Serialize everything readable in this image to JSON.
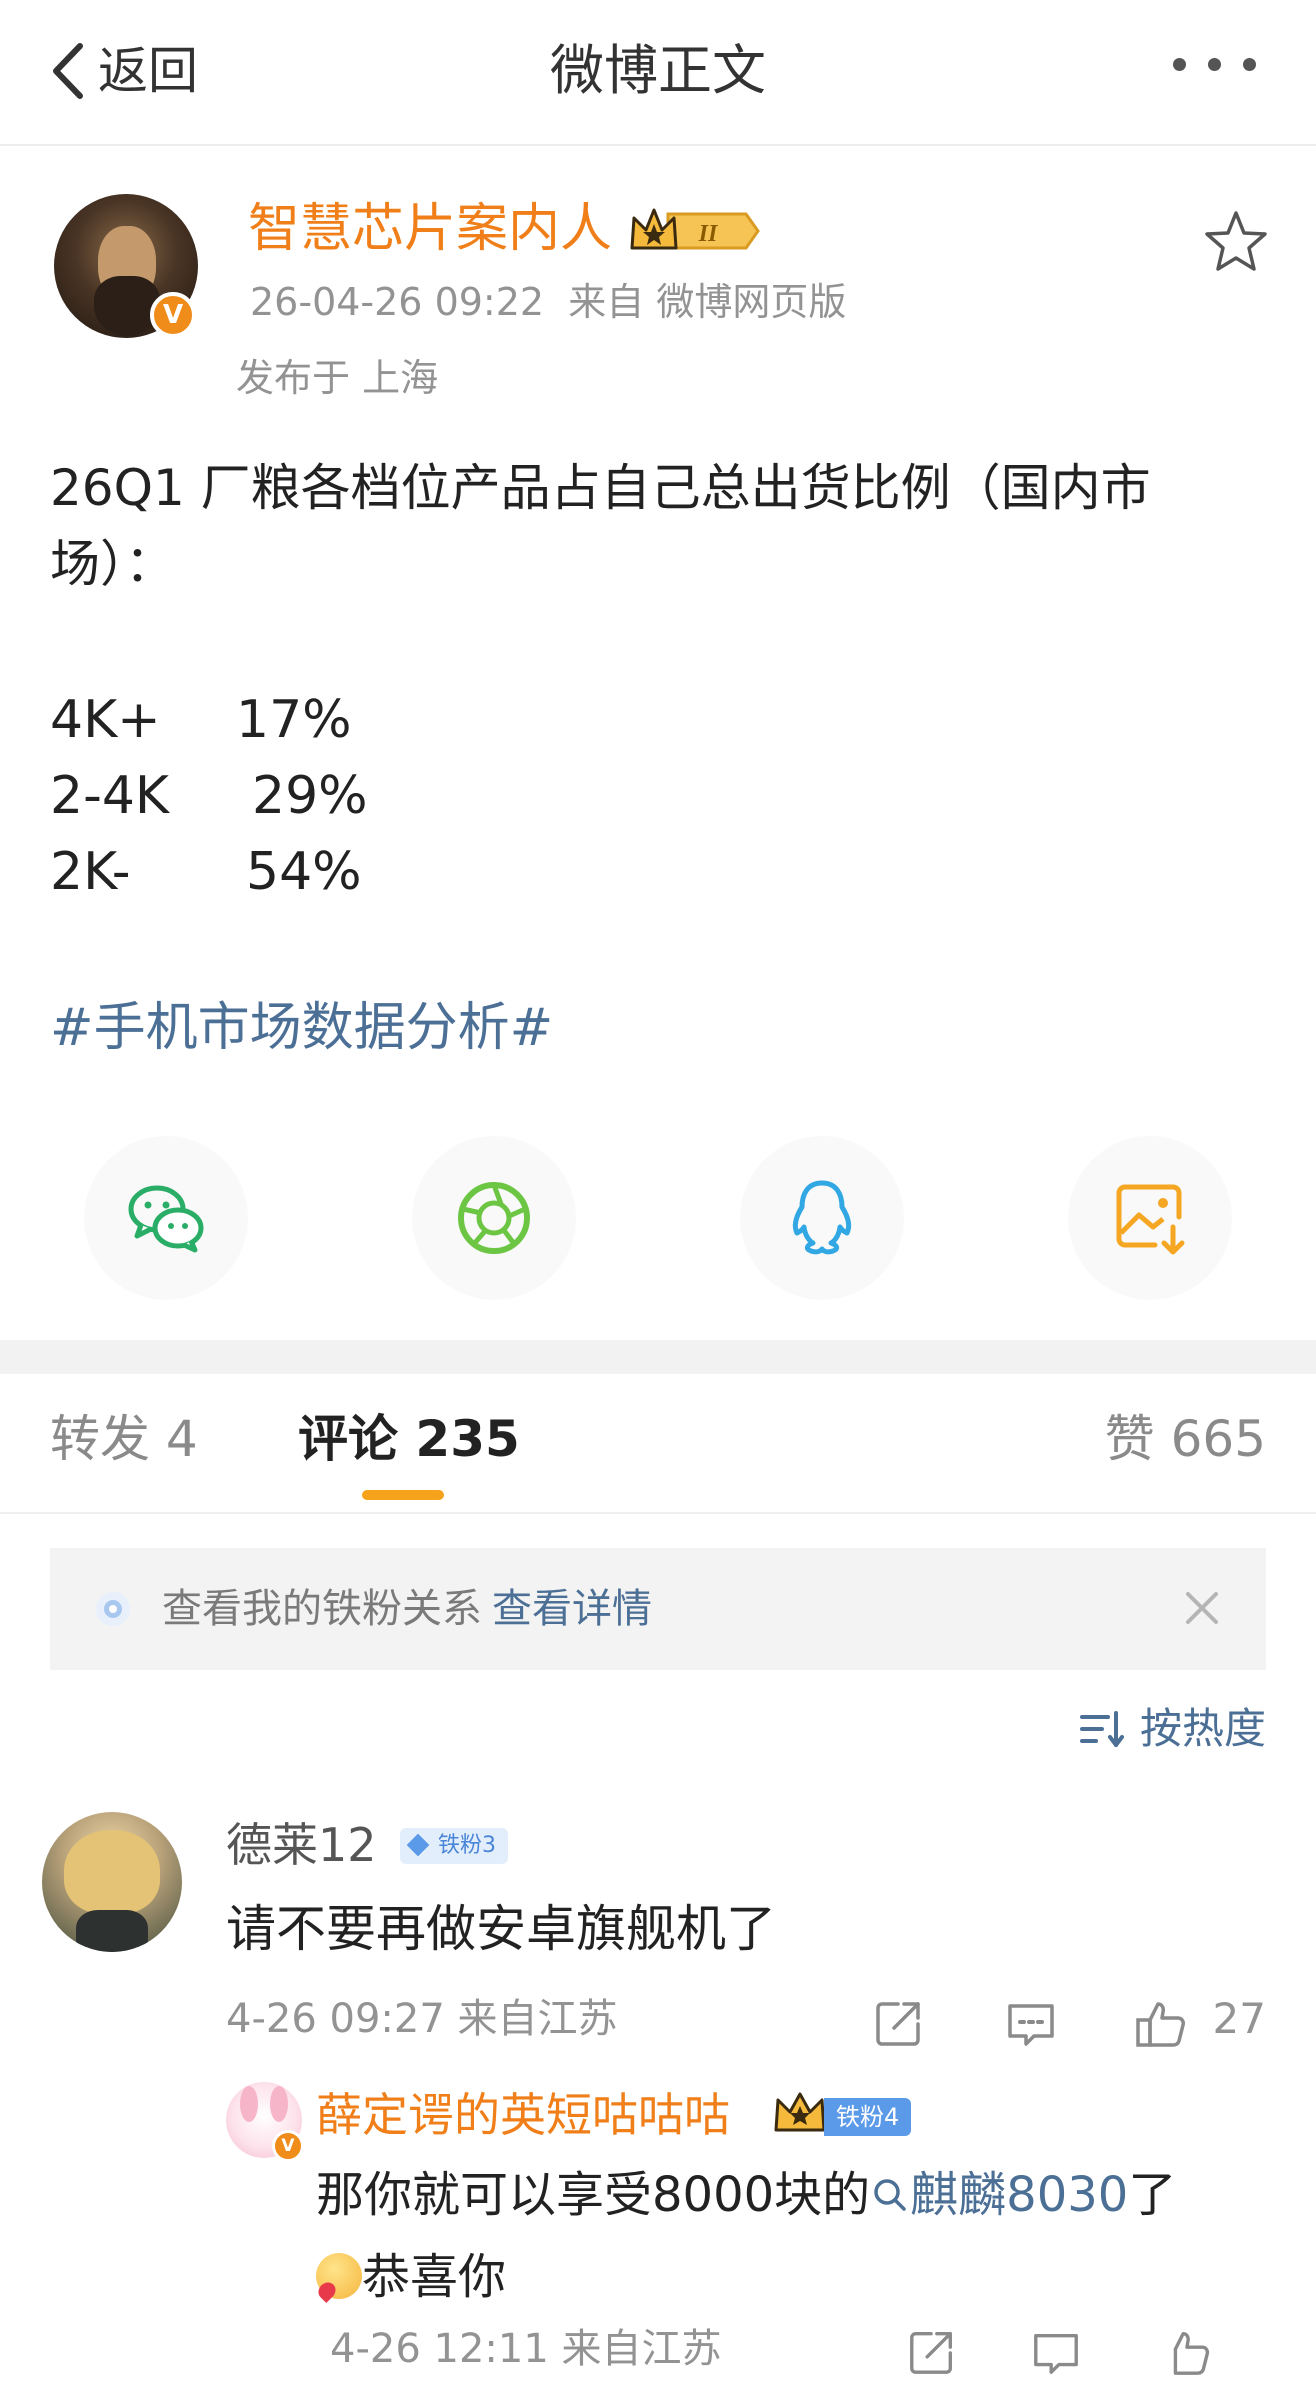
{
  "header": {
    "back_label": "返回",
    "title": "微博正文",
    "icons": {
      "back": "chevron-left-icon",
      "more": "more-horizontal-icon"
    }
  },
  "post": {
    "author": {
      "name": "智慧芯片案内人",
      "verified_badge": "V",
      "level_badge": "II"
    },
    "timestamp": "26-04-26 09:22",
    "source": "来自 微博网页版",
    "location": "发布于 上海",
    "content": "26Q1 厂粮各档位产品占自己总出货比例（国内市场）：",
    "stats": [
      {
        "label": "4K+",
        "value": "17%"
      },
      {
        "label": "2-4K",
        "value": "29%"
      },
      {
        "label": "2K-",
        "value": "54%"
      }
    ],
    "hashtag": "#手机市场数据分析#",
    "share_icons": [
      "wechat-icon",
      "moments-icon",
      "qq-icon",
      "save-image-icon"
    ]
  },
  "tabs": {
    "repost": "转发 4",
    "comment": "评论 235",
    "like": "赞 665",
    "active": "comment"
  },
  "fan_banner": {
    "text": "查看我的铁粉关系",
    "link": "查看详情"
  },
  "sort": {
    "label": "按热度"
  },
  "comments": [
    {
      "user": "德莱12",
      "fan_badge": "铁粉3",
      "text": "请不要再做安卓旗舰机了",
      "meta": "4-26 09:27 来自江苏",
      "likes": "27",
      "reply": {
        "user": "薛定谔的英短咕咕咕",
        "verified_badge": "V",
        "fan_badge": "铁粉4",
        "text_before": "那你就可以享受8000块的",
        "link": "麒麟8030",
        "text_after": "了",
        "text_line2": "恭喜你",
        "meta": "4-26 12:11 来自江苏"
      }
    }
  ],
  "colors": {
    "accent_orange": "#f07f1a",
    "link_blue": "#4c6f96",
    "tab_indicator": "#f7a21b",
    "meta_gray": "#939393",
    "wechat_green": "#2aae67",
    "moments_green": "#6cc644",
    "qq_blue": "#31a7e3",
    "save_orange": "#f5a623"
  }
}
